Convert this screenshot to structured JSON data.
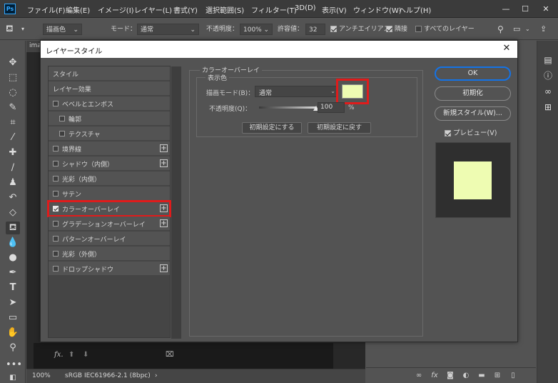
{
  "app": {
    "logo": "Ps",
    "menu": [
      "ファイル(F)",
      "編集(E)",
      "イメージ(I)",
      "レイヤー(L)",
      "書式(Y)",
      "選択範囲(S)",
      "フィルター(T)",
      "3D(D)",
      "表示(V)",
      "ウィンドウ(W)",
      "ヘルプ(H)"
    ],
    "window_controls": [
      "—",
      "☐",
      "✕"
    ]
  },
  "options_bar": {
    "fill_source": "描画色",
    "mode_label": "モード：",
    "mode_value": "通常",
    "opacity_label": "不透明度：",
    "opacity_value": "100%",
    "tolerance_label": "許容値：",
    "tolerance_value": "32",
    "antialias_label": "アンチエイリアス",
    "contiguous_label": "隣接",
    "all_layers_label": "すべてのレイヤー"
  },
  "document": {
    "tab_label": "ima",
    "zoom": "100%",
    "color_profile": "sRGB IEC61966-2.1 (8bpc)",
    "status_caret": "›"
  },
  "dialog": {
    "title": "レイヤースタイル",
    "close_glyph": "✕",
    "style_list": [
      {
        "label": "スタイル",
        "checkbox": false,
        "checked": false,
        "plus": false,
        "indent": false,
        "header": true
      },
      {
        "label": "レイヤー効果",
        "checkbox": false,
        "checked": false,
        "plus": false,
        "indent": false,
        "header": true
      },
      {
        "label": "ベベルとエンボス",
        "checkbox": true,
        "checked": false,
        "plus": false,
        "indent": false
      },
      {
        "label": "輪郭",
        "checkbox": true,
        "checked": false,
        "plus": false,
        "indent": true
      },
      {
        "label": "テクスチャ",
        "checkbox": true,
        "checked": false,
        "plus": false,
        "indent": true
      },
      {
        "label": "境界線",
        "checkbox": true,
        "checked": false,
        "plus": true,
        "indent": false
      },
      {
        "label": "シャドウ（内側）",
        "checkbox": true,
        "checked": false,
        "plus": true,
        "indent": false
      },
      {
        "label": "光彩（内側）",
        "checkbox": true,
        "checked": false,
        "plus": false,
        "indent": false
      },
      {
        "label": "サテン",
        "checkbox": true,
        "checked": false,
        "plus": false,
        "indent": false
      },
      {
        "label": "カラーオーバーレイ",
        "checkbox": true,
        "checked": true,
        "plus": true,
        "indent": false,
        "selected": true
      },
      {
        "label": "グラデーションオーバーレイ",
        "checkbox": true,
        "checked": false,
        "plus": true,
        "indent": false
      },
      {
        "label": "パターンオーバーレイ",
        "checkbox": true,
        "checked": false,
        "plus": false,
        "indent": false
      },
      {
        "label": "光彩（外側）",
        "checkbox": true,
        "checked": false,
        "plus": false,
        "indent": false
      },
      {
        "label": "ドロップシャドウ",
        "checkbox": true,
        "checked": false,
        "plus": true,
        "indent": false
      }
    ],
    "footer_fx": "fx.",
    "footer_up": "⬆",
    "footer_down": "⬇",
    "footer_trash": "🗑",
    "section_title": "カラーオーバーレイ",
    "subsection_title": "表示色",
    "blend_label": "描画モード(B)：",
    "blend_value": "通常",
    "overlay_color": "#eefcb2",
    "opacity_label": "不透明度(Q)：",
    "opacity_value": "100",
    "opacity_unit": "%",
    "opacity_fraction": 1.0,
    "make_default": "初期設定にする",
    "reset_default": "初期設定に戻す",
    "ok": "OK",
    "reset": "初期化",
    "new_style": "新規スタイル(W)...",
    "preview_label": "プレビュー(V)",
    "preview_checked": true
  },
  "highlight_color": "#e01b1b"
}
